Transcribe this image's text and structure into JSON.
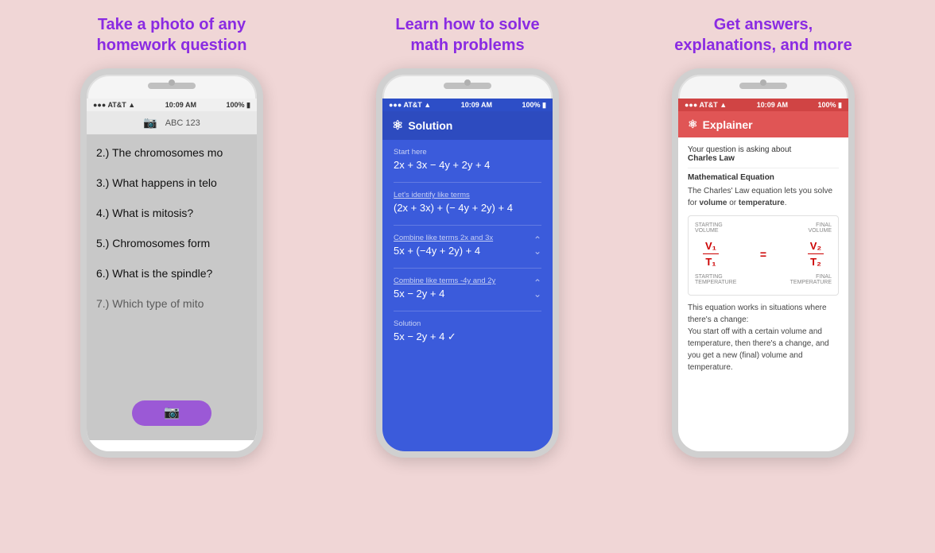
{
  "background_color": "#f0d6d6",
  "panels": [
    {
      "id": "panel1",
      "title": "Take a photo of any\nhomework question",
      "title_color": "#8a2be2",
      "phone": {
        "status": "AT&T  10:09 AM  100%",
        "type": "camera",
        "header_icon": "camera",
        "header_text": "ABC  123",
        "lines": [
          "2.) The chromosomes mo",
          "3.) What happens in telo",
          "4.) What is mitosis?",
          "5.) Chromosomes form",
          "6.) What is the spindle?",
          "7.) Which type of mito"
        ]
      }
    },
    {
      "id": "panel2",
      "title": "Learn how to solve\nmath problems",
      "title_color": "#8a2be2",
      "phone": {
        "status": "AT&T  10:09 AM  100%",
        "type": "solution",
        "header_icon": "infinity",
        "header_text": "Solution",
        "steps": [
          {
            "label": "Start here",
            "equation": "2x + 3x − 4y + 2y + 4",
            "underline": false
          },
          {
            "label": "Let's identify like terms",
            "equation": "(2x + 3x) + (− 4y + 2y) + 4",
            "underline": true
          },
          {
            "label": "Combine like terms 2x and 3x",
            "equation": "5x + (−4y + 2y) + 4",
            "underline": true,
            "has_arrow": true
          },
          {
            "label": "Combine like terms -4y and 2y",
            "equation": "5x − 2y + 4",
            "underline": true,
            "has_arrow": true
          },
          {
            "label": "Solution",
            "equation": "5x − 2y + 4  ✓",
            "underline": false
          }
        ]
      }
    },
    {
      "id": "panel3",
      "title": "Get answers,\nexplanations, and more",
      "title_color": "#8a2be2",
      "phone": {
        "status": "AT&T  10:09 AM  100%",
        "type": "explainer",
        "header_icon": "infinity",
        "header_text": "Explainer",
        "intro": "Your question is asking about",
        "topic_bold": "Charles Law",
        "section_title": "Mathematical Equation",
        "section_text": "The Charles' Law equation lets you solve for",
        "keywords": [
          "volume",
          "temperature"
        ],
        "diagram": {
          "top_labels": [
            "STARTING\nVOLUME",
            "FINAL\nVOLUME"
          ],
          "numerators": [
            "V₁",
            "V₂"
          ],
          "denominators": [
            "T₁",
            "T₂"
          ],
          "bottom_labels": [
            "STARTING\nTEMPERATURE",
            "FINAL\nTEMPERATURE"
          ]
        },
        "conclusion": "This equation works in situations where there's a change:\nYou start off with a certain volume and temperature, then there's a change, and you get a new (final) volume and temperature."
      }
    }
  ]
}
